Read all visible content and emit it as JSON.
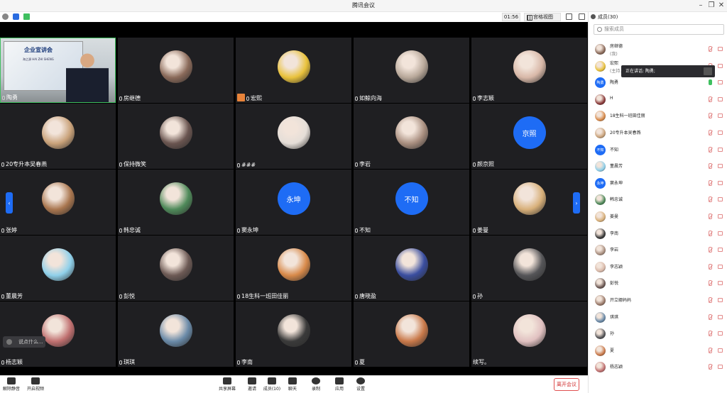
{
  "window": {
    "title": "腾讯会议"
  },
  "toolbar": {
    "timer": "01:56",
    "view_label": "宫格视图"
  },
  "stage": {
    "tiles": [
      {
        "name": "陶勇",
        "kind": "video",
        "screen_title": "企业宣讲会",
        "screen_sub": "海之源 HAI ZHI SHENG"
      },
      {
        "name": "房继德",
        "kind": "avatar",
        "color": "#8a6a5a"
      },
      {
        "name": "宏熙",
        "kind": "avatar",
        "color": "#e9c23c",
        "host": true
      },
      {
        "name": "如鲸向海",
        "kind": "avatar",
        "color": "#b8a89a"
      },
      {
        "name": "李志颖",
        "kind": "avatar",
        "color": "#d8b8a8"
      },
      {
        "name": "20专升本吴春燕",
        "kind": "avatar",
        "color": "#c9a27a"
      },
      {
        "name": "保持微笑",
        "kind": "avatar",
        "color": "#6a5550"
      },
      {
        "name": "###",
        "kind": "avatar",
        "color": "#e5ded8"
      },
      {
        "name": "李岩",
        "kind": "avatar",
        "color": "#a98f80"
      },
      {
        "name": "颜京照",
        "kind": "text",
        "initials": "京照"
      },
      {
        "name": "张婷",
        "kind": "avatar",
        "color": "#a9764f"
      },
      {
        "name": "韩忠诚",
        "kind": "avatar",
        "color": "#4f8a5a"
      },
      {
        "name": "窦永坤",
        "kind": "text",
        "initials": "永坤"
      },
      {
        "name": "不知",
        "kind": "text",
        "initials": "不知"
      },
      {
        "name": "姜曼",
        "kind": "avatar",
        "color": "#d8b07a"
      },
      {
        "name": "董晨芳",
        "kind": "avatar",
        "color": "#8fd0ea"
      },
      {
        "name": "彭悦",
        "kind": "avatar",
        "color": "#6d5a55"
      },
      {
        "name": "18生科一班田佳丽",
        "kind": "avatar",
        "color": "#d88a4a"
      },
      {
        "name": "唐晓盈",
        "kind": "avatar",
        "color": "#3a4ea0"
      },
      {
        "name": "孙",
        "kind": "avatar",
        "color": "#555558"
      },
      {
        "name": "杨志颖",
        "kind": "avatar",
        "color": "#c07070"
      },
      {
        "name": "琪琪",
        "kind": "avatar",
        "color": "#6a8aa8"
      },
      {
        "name": "李南",
        "kind": "avatar",
        "color": "#3a3a3a"
      },
      {
        "name": "夏",
        "kind": "avatar",
        "color": "#c9794a"
      },
      {
        "name": "续写。",
        "kind": "avatar",
        "color": "#e0c0c0",
        "no_mic": true
      }
    ],
    "chat_placeholder": "说点什么..."
  },
  "bottombar": {
    "mute_label": "解除静音",
    "video_label": "开启视频",
    "share_label": "共享屏幕",
    "invite_label": "邀请",
    "members_label": "成员(10)",
    "chat_label": "聊天",
    "record_label": "录制",
    "apps_label": "应用",
    "settings_label": "设置",
    "leave_label": "离开会议"
  },
  "panel": {
    "title": "成员(30)",
    "search_placeholder": "搜索成员",
    "speaking_label": "正在讲话: 陶勇;",
    "members": [
      {
        "name": "房继德",
        "sub": "(我)",
        "color": "#8a6a5a"
      },
      {
        "name": "宏熙",
        "sub": "(主持...",
        "color": "#e9c23c"
      },
      {
        "name": "陶勇",
        "kind": "text",
        "initials": "陶勇",
        "mic_on": true
      },
      {
        "name": "H",
        "color": "#8a3a3a"
      },
      {
        "name": "18生科一班田佳丽",
        "color": "#d88a4a"
      },
      {
        "name": "20专升本吴春燕",
        "color": "#c9a27a"
      },
      {
        "name": "不知",
        "kind": "text",
        "initials": "不知"
      },
      {
        "name": "董晨芳",
        "color": "#8fd0ea"
      },
      {
        "name": "窦永坤",
        "kind": "text",
        "initials": "永坤"
      },
      {
        "name": "韩忠诚",
        "color": "#4f8a5a"
      },
      {
        "name": "姜曼",
        "color": "#d8b07a"
      },
      {
        "name": "李南",
        "color": "#3a3a3a"
      },
      {
        "name": "李岩",
        "color": "#a98f80"
      },
      {
        "name": "李志颖",
        "color": "#d8b8a8"
      },
      {
        "name": "彭悦",
        "color": "#6d5a55"
      },
      {
        "name": "开立娜妈妈",
        "color": "#9a7a6a"
      },
      {
        "name": "琪琪",
        "color": "#6a8aa8"
      },
      {
        "name": "孙",
        "color": "#555558"
      },
      {
        "name": "夏",
        "color": "#c9794a"
      },
      {
        "name": "杨志颖",
        "color": "#c07070"
      }
    ]
  }
}
